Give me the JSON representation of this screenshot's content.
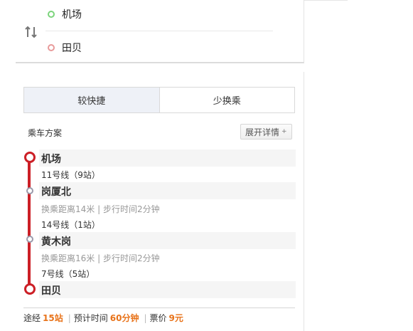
{
  "search": {
    "origin": "机场",
    "destination": "田贝"
  },
  "tabs": [
    {
      "label": "较快捷",
      "active": true
    },
    {
      "label": "少换乘",
      "active": false
    }
  ],
  "plan": {
    "title": "乘车方案",
    "expand_label": "展开详情",
    "expand_icon": "+"
  },
  "route": {
    "stations": [
      "机场",
      "岗厦北",
      "黄木岗",
      "田贝"
    ],
    "segments": [
      {
        "line": "11号线（9站）"
      },
      {
        "transfer": "换乘距离14米 | 步行时间2分钟",
        "line": "14号线（1站）"
      },
      {
        "transfer": "换乘距离16米 | 步行时间2分钟",
        "line": "7号线（5站）"
      }
    ]
  },
  "summary": {
    "via_label": "途经",
    "stops": "15站",
    "time_label": "预计时间",
    "time": "60分钟",
    "fare_label": "票价",
    "fare": "9元"
  },
  "colors": {
    "line_red": "#cc1f26",
    "highlight_orange": "#e8731a",
    "origin_dot": "#7bd47b",
    "destination_dot": "#e89a9a"
  },
  "icons": {
    "swap": "swap-arrows-icon"
  }
}
